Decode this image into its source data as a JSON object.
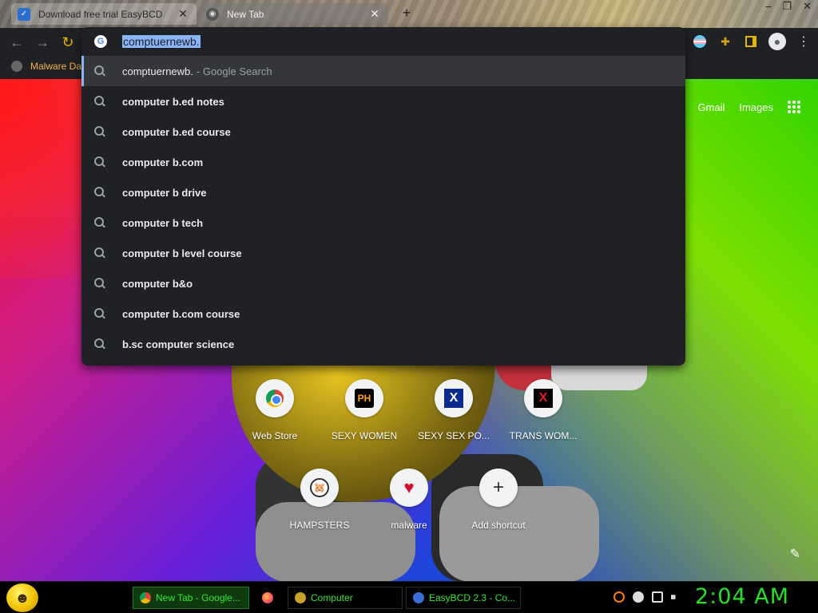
{
  "tabs": [
    {
      "title": "Download free trial EasyBCD",
      "active": false
    },
    {
      "title": "New Tab",
      "active": true
    }
  ],
  "window_controls": [
    "–",
    "❐",
    "✕"
  ],
  "bookmarks": [
    {
      "label": "Malware Da"
    }
  ],
  "omnibox": {
    "input_value": "comptuernewb.",
    "suggestions": [
      {
        "text": "comptuernewb.",
        "suffix": "- Google Search",
        "selected": true,
        "bold": false
      },
      {
        "text": "computer b.ed notes",
        "suffix": "",
        "selected": false,
        "bold": true
      },
      {
        "text": "computer b.ed course",
        "suffix": "",
        "selected": false,
        "bold": true
      },
      {
        "text": "computer b.com",
        "suffix": "",
        "selected": false,
        "bold": true
      },
      {
        "text": "computer b drive",
        "suffix": "",
        "selected": false,
        "bold": true
      },
      {
        "text": "computer b tech",
        "suffix": "",
        "selected": false,
        "bold": true
      },
      {
        "text": "computer b level course",
        "suffix": "",
        "selected": false,
        "bold": true
      },
      {
        "text": "computer b&o",
        "suffix": "",
        "selected": false,
        "bold": true
      },
      {
        "text": "computer b.com course",
        "suffix": "",
        "selected": false,
        "bold": true
      },
      {
        "text": "b.sc computer science",
        "suffix": "",
        "selected": false,
        "bold": true
      }
    ]
  },
  "google_links": {
    "gmail": "Gmail",
    "images": "Images"
  },
  "shortcuts": [
    {
      "label": "Web Store",
      "icon": "chrome-web-store-icon"
    },
    {
      "label": "SEXY WOMEN",
      "icon": "ph-icon",
      "icon_text": "PH"
    },
    {
      "label": "SEXY SEX PO...",
      "icon": "x-blue-icon",
      "icon_text": "X"
    },
    {
      "label": "TRANS WOM...",
      "icon": "x-red-icon",
      "icon_text": "X"
    },
    {
      "label": "HAMPSTERS",
      "icon": "hamster-icon"
    },
    {
      "label": "malware",
      "icon": "heart-icon"
    },
    {
      "label": "Add shortcut",
      "icon": "plus-icon"
    }
  ],
  "taskbar": {
    "items": [
      {
        "label": "New Tab - Google...",
        "icon": "chrome-icon",
        "active": true
      },
      {
        "label": "",
        "icon": "firefox-icon",
        "active": false
      },
      {
        "label": "Computer",
        "icon": "folder-icon",
        "active": false
      },
      {
        "label": "EasyBCD 2.3 - Co...",
        "icon": "easybcd-icon",
        "active": false
      }
    ],
    "clock": "2:04 AM"
  },
  "colors": {
    "accent": "#8ab4f8",
    "taskbar_text": "#2ee82e",
    "bookmark_text": "#f3b23d"
  }
}
